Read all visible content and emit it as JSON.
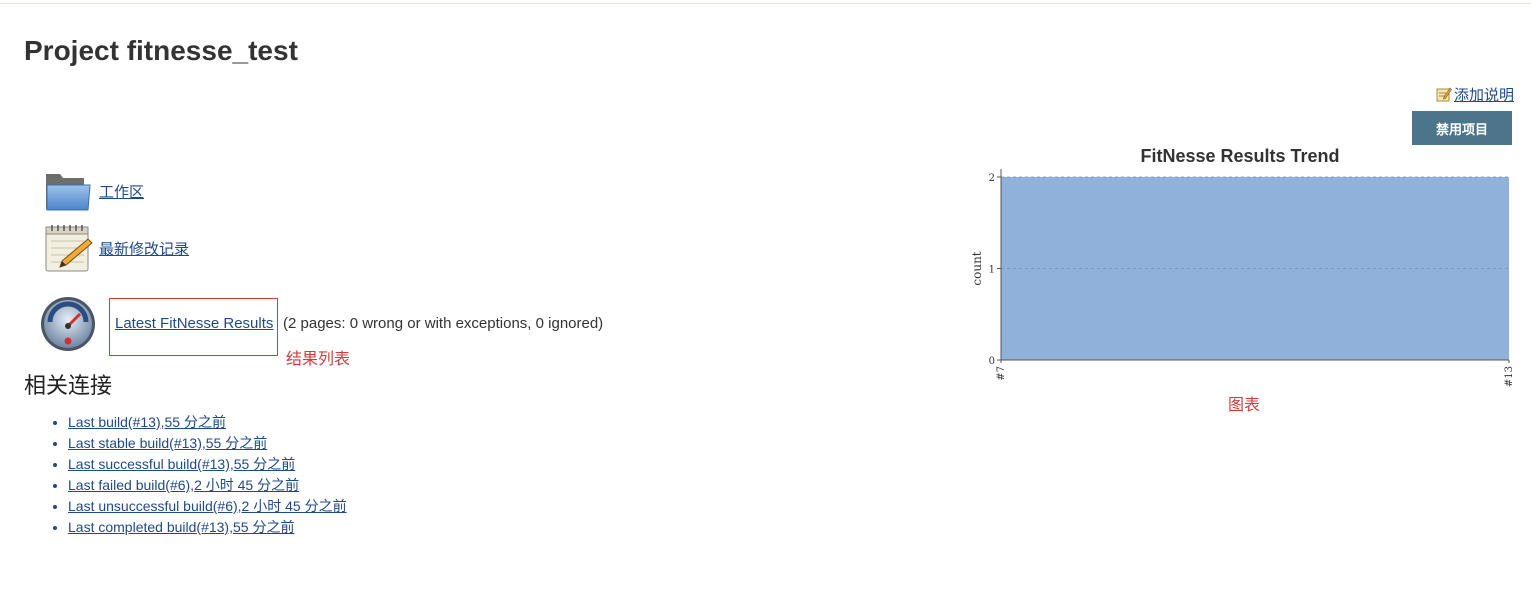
{
  "page": {
    "title": "Project fitnesse_test"
  },
  "header": {
    "add_description": "添加说明",
    "disable_button": "禁用项目"
  },
  "tasks": [
    {
      "icon": "folder-icon",
      "label": "工作区"
    },
    {
      "icon": "notepad-icon",
      "label": "最新修改记录"
    }
  ],
  "fitnesse": {
    "icon": "fitnesse-gauge-icon",
    "link_label": "Latest FitNesse Results",
    "summary": "(2 pages: 0 wrong or with exceptions, 0 ignored)"
  },
  "annotations": {
    "results": "结果列表",
    "chart": "图表",
    "color": "#d23c3c"
  },
  "permalinks": {
    "title": "相关连接",
    "items": [
      "Last build(#13),55 分之前",
      "Last stable build(#13),55 分之前",
      "Last successful build(#13),55 分之前",
      "Last failed build(#6),2 小时 45 分之前",
      "Last unsuccessful build(#6),2 小时 45 分之前",
      "Last completed build(#13),55 分之前"
    ]
  },
  "colors": {
    "link": "#204a87",
    "button": "#4b758b",
    "area_fill": "#8fb1da"
  },
  "chart_data": {
    "type": "area",
    "title": "FitNesse Results Trend",
    "ylabel": "count",
    "xlabel": "",
    "x": [
      "#7",
      "#13"
    ],
    "series": [
      {
        "values": [
          2,
          2
        ]
      }
    ],
    "ylim": [
      0,
      2
    ],
    "yticks": [
      0,
      1,
      2
    ],
    "grid": true
  }
}
